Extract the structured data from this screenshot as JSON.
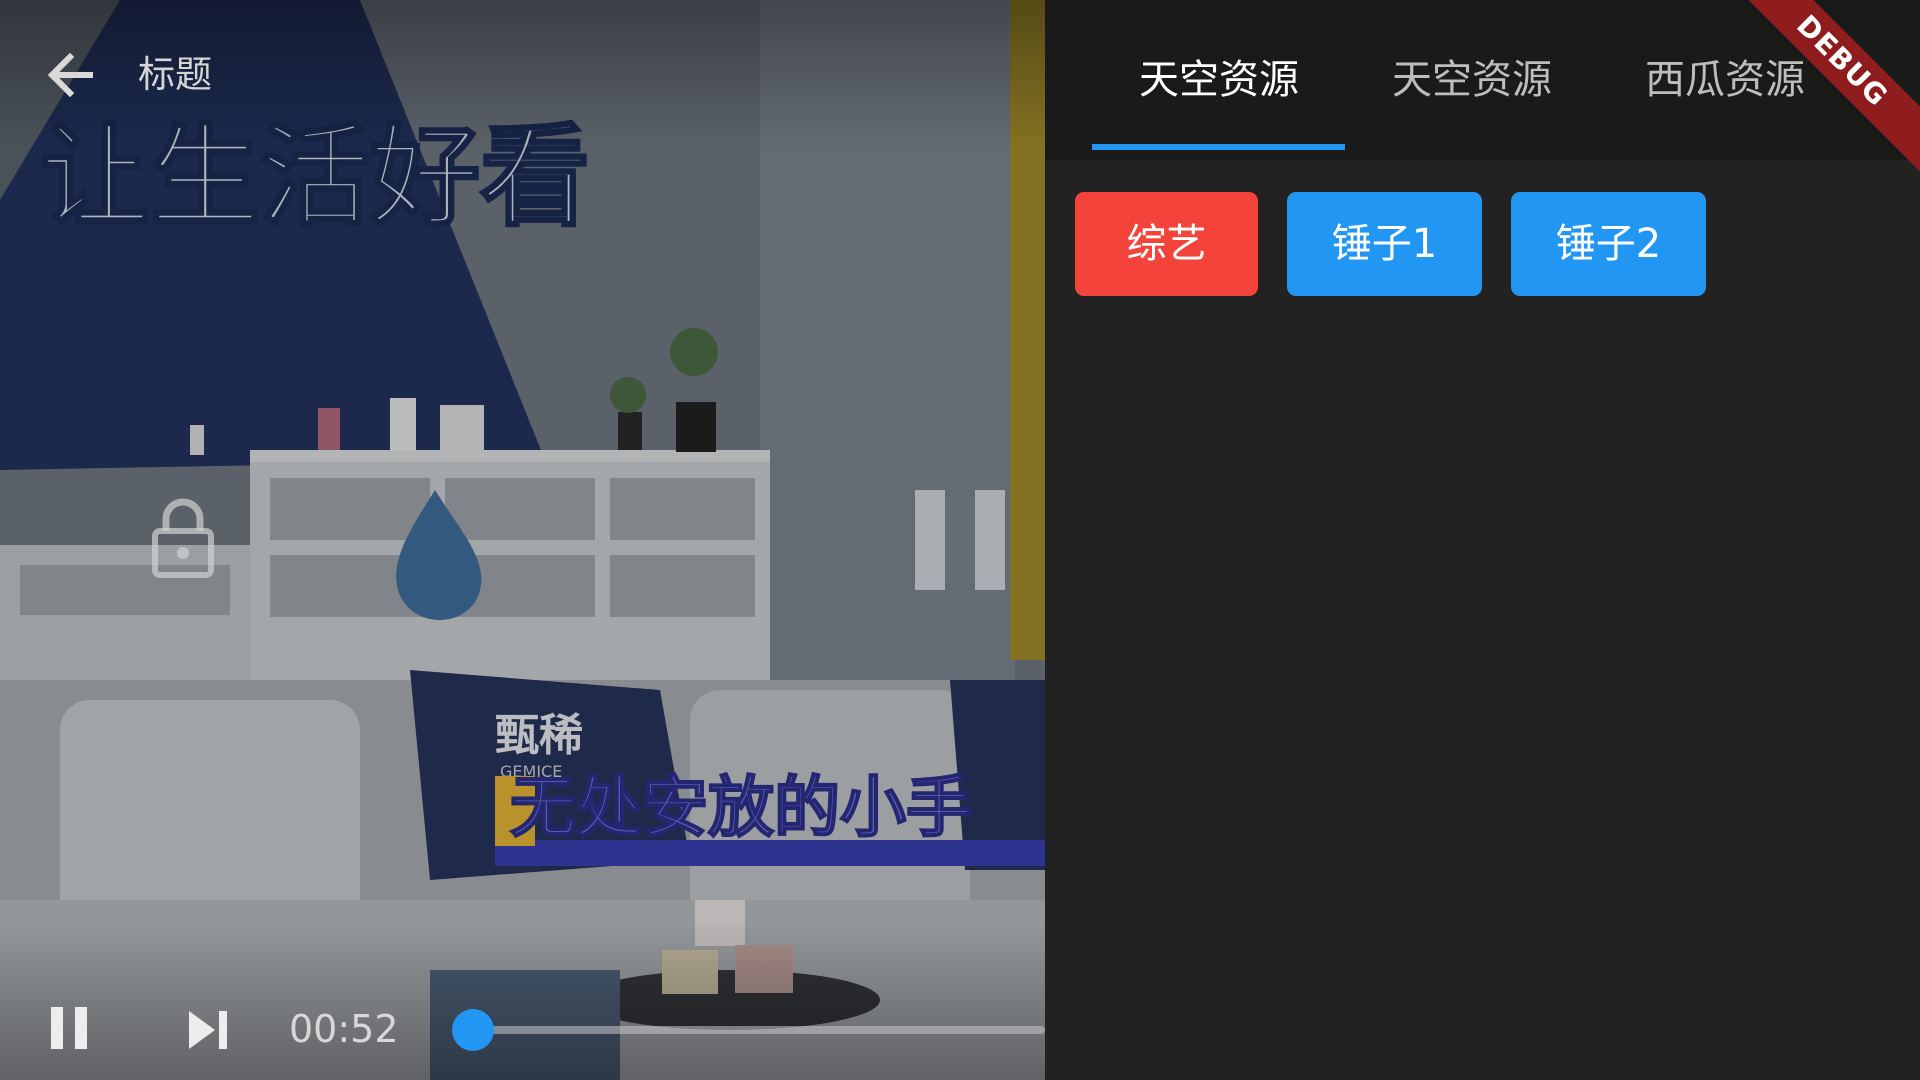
{
  "player": {
    "title": "标题",
    "current_time": "00:52",
    "progress_fraction": 0.03,
    "scene": {
      "sign_text": "让生活好看",
      "brand_text": "甄稀",
      "brand_sub": "GEMICE",
      "caption": "无处安放的小手"
    }
  },
  "source_tabs": [
    {
      "label": "天空资源",
      "active": true
    },
    {
      "label": "天空资源",
      "active": false
    },
    {
      "label": "西瓜资源",
      "active": false
    }
  ],
  "categories": [
    {
      "label": "综艺",
      "selected": true
    },
    {
      "label": "锤子1",
      "selected": false
    },
    {
      "label": "锤子2",
      "selected": false
    }
  ],
  "debug_banner": "DEBUG",
  "colors": {
    "accent": "#2196f3",
    "selected_chip": "#f4433a",
    "panel_bg": "#222222",
    "tabbar_bg": "#1a1a1a",
    "debug_banner": "#8e1c1c"
  },
  "icons": {
    "back": "arrow-left-icon",
    "lock": "lock-icon",
    "pause": "pause-icon",
    "next": "skip-next-icon"
  }
}
